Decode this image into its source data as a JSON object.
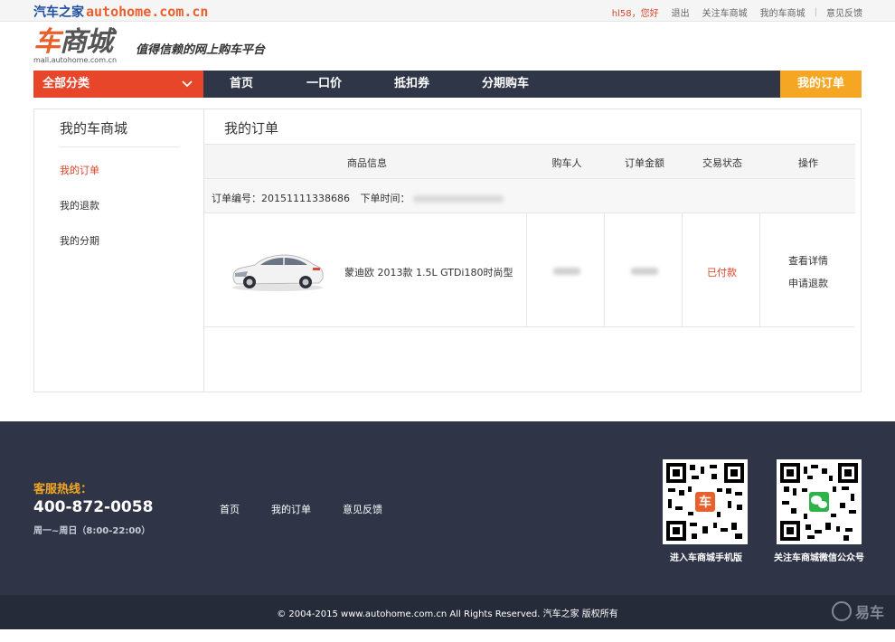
{
  "topbar": {
    "brand_cn": "汽车之家",
    "brand_en": "autohome.com.cn",
    "user": "hl58，您好",
    "logout": "退出",
    "follow": "关注车商城",
    "my_mall": "我的车商城",
    "separator": "|",
    "feedback": "意见反馈"
  },
  "logo": {
    "che": "车",
    "shangcheng": "商城",
    "domain": "mall.autohome.com.cn",
    "slogan": "值得信赖的网上购车平台"
  },
  "nav": {
    "category": "全部分类",
    "items": [
      "首页",
      "一口价",
      "抵扣券",
      "分期购车"
    ],
    "my_order": "我的订单"
  },
  "sidebar": {
    "title": "我的车商城",
    "items": [
      {
        "label": "我的订单",
        "active": true
      },
      {
        "label": "我的退款",
        "active": false
      },
      {
        "label": "我的分期",
        "active": false
      }
    ]
  },
  "main": {
    "title": "我的订单",
    "headers": [
      "商品信息",
      "购车人",
      "订单金额",
      "交易状态",
      "操作"
    ],
    "order_no_label": "订单编号：20151111338686",
    "order_time_label": "下单时间：",
    "product_name": "蒙迪欧 2013款 1.5L GTDi180时尚型",
    "status": "已付款",
    "ops": [
      "查看详情",
      "申请退款"
    ]
  },
  "footer": {
    "hotline_label": "客服热线：",
    "hotline_number": "400-872-0058",
    "hotline_time": "周一~周日（8:00-22:00）",
    "links": [
      "首页",
      "我的订单",
      "意见反馈"
    ],
    "qr1_label": "进入车商城手机版",
    "qr2_label": "关注车商城微信公众号",
    "copyright": "© 2004-2015 www.autohome.com.cn All Rights Reserved. 汽车之家 版权所有",
    "watermark": "易车"
  },
  "colors": {
    "accent_red": "#e8462b",
    "accent_orange": "#f5a623",
    "nav_dark": "#2e3648",
    "footer_dark": "#2f3547"
  }
}
